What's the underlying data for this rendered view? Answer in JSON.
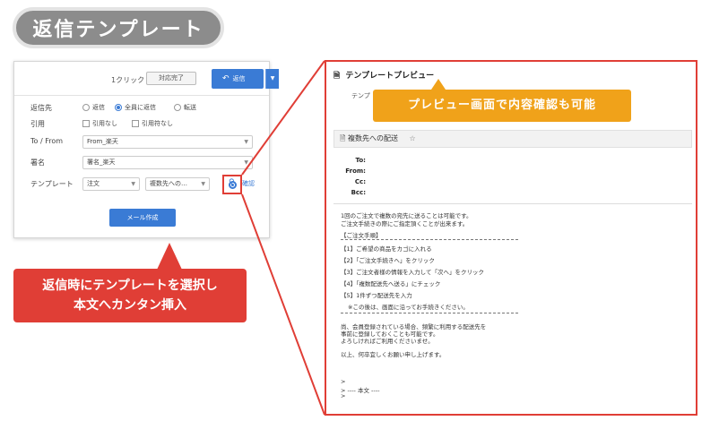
{
  "title": "返信テンプレート",
  "form": {
    "click_label": "1クリック",
    "done_button": "対応完了",
    "reply_button": "返信",
    "reply_to": {
      "label": "返信先",
      "options": [
        "返信",
        "全員に返信",
        "転送"
      ],
      "selected": "全員に返信"
    },
    "quote": {
      "label": "引用",
      "options": [
        "引用なし",
        "引用符なし"
      ]
    },
    "to_from": {
      "label": "To / From",
      "value": "From_楽天"
    },
    "signature": {
      "label": "署名",
      "value": "署名_楽天"
    },
    "template": {
      "label": "テンプレート",
      "category": "注文",
      "value": "複数先への…",
      "check_label": "確認"
    },
    "compose_button": "メール作成"
  },
  "callout": {
    "line1": "返信時にテンプレートを選択し",
    "line2": "本文へカンタン挿入"
  },
  "preview": {
    "title": "テンプレートプレビュー",
    "sub_label": "テンプ",
    "banner": "プレビュー画面で内容確認も可能",
    "mail_subject": "複数先への配送",
    "headers": [
      "To:",
      "From:",
      "Cc:",
      "Bcc:"
    ],
    "body": {
      "intro1": "1回のご注文で複数の宛先に送ることは可能です。",
      "intro2": "ご注文手続きの際にご指定頂くことが出来ます。",
      "section": "【ご注文手順】",
      "step1": "【1】ご希望の商品をカゴに入れる",
      "step2": "【2】「ご注文手続きへ」をクリック",
      "step3": "【3】ご注文者様の情報を入力して「次へ」をクリック",
      "step4": "【4】「複数配送先へ送る」にチェック",
      "step5": "【5】1件ずつ配送先を入力",
      "note": "※この後は、画面に沿ってお手続きください。",
      "member1": "尚、会員登録されている場合、頻繁に利用する配送先を",
      "member2": "事前に登録しておくことも可能です。",
      "member3": "よろしければご利用くださいませ。",
      "closing": "以上、何卒宜しくお願い申し上げます。",
      "quote1": ">",
      "quote2": "> ---- 本文 ----",
      "quote3": ">"
    }
  }
}
